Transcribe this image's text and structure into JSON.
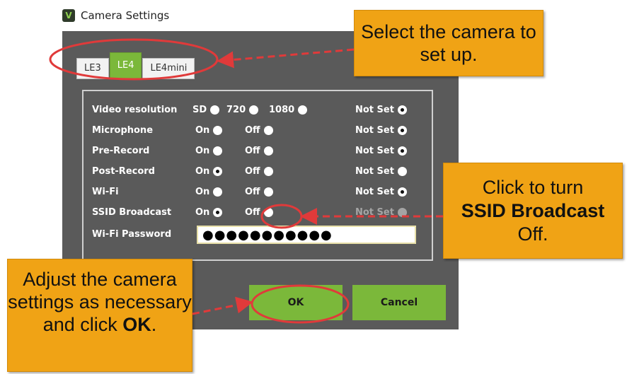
{
  "window": {
    "title": "Camera Settings",
    "icon": "v-logo-icon"
  },
  "tabs": [
    {
      "label": "LE3",
      "active": false
    },
    {
      "label": "LE4",
      "active": true
    },
    {
      "label": "LE4mini",
      "active": false
    }
  ],
  "settings": {
    "video_resolution": {
      "label": "Video resolution",
      "options": [
        "SD",
        "720",
        "1080",
        "Not Set"
      ],
      "selected": "Not Set"
    },
    "microphone": {
      "label": "Microphone",
      "on": "On",
      "off": "Off",
      "not_set": "Not Set",
      "selected": "Not Set"
    },
    "pre_record": {
      "label": "Pre-Record",
      "on": "On",
      "off": "Off",
      "not_set": "Not Set",
      "selected": "Not Set"
    },
    "post_record": {
      "label": "Post-Record",
      "on": "On",
      "off": "Off",
      "not_set": "Not Set",
      "selected": "On"
    },
    "wifi": {
      "label": "Wi-Fi",
      "on": "On",
      "off": "Off",
      "not_set": "Not Set",
      "selected": "Not Set"
    },
    "ssid_broadcast": {
      "label": "SSID Broadcast",
      "on": "On",
      "off": "Off",
      "not_set": "Not Set",
      "selected": "On"
    },
    "wifi_password": {
      "label": "Wi-Fi Password",
      "value": "●●●●●●●●●●●"
    }
  },
  "buttons": {
    "ok": "OK",
    "cancel": "Cancel"
  },
  "callouts": {
    "select_camera": "Select the camera to set up.",
    "ssid_pre": "Click to turn",
    "ssid_bold": "SSID Broadcast",
    "ssid_post": "Off.",
    "adjust_pre": "Adjust the camera settings as necessary and click",
    "adjust_bold": "OK",
    "adjust_post": "."
  },
  "colors": {
    "accent_green": "#7bb83a",
    "callout_orange": "#f0a315",
    "highlight_red": "#e03a3a",
    "dialog_bg": "#5a5a5a"
  }
}
